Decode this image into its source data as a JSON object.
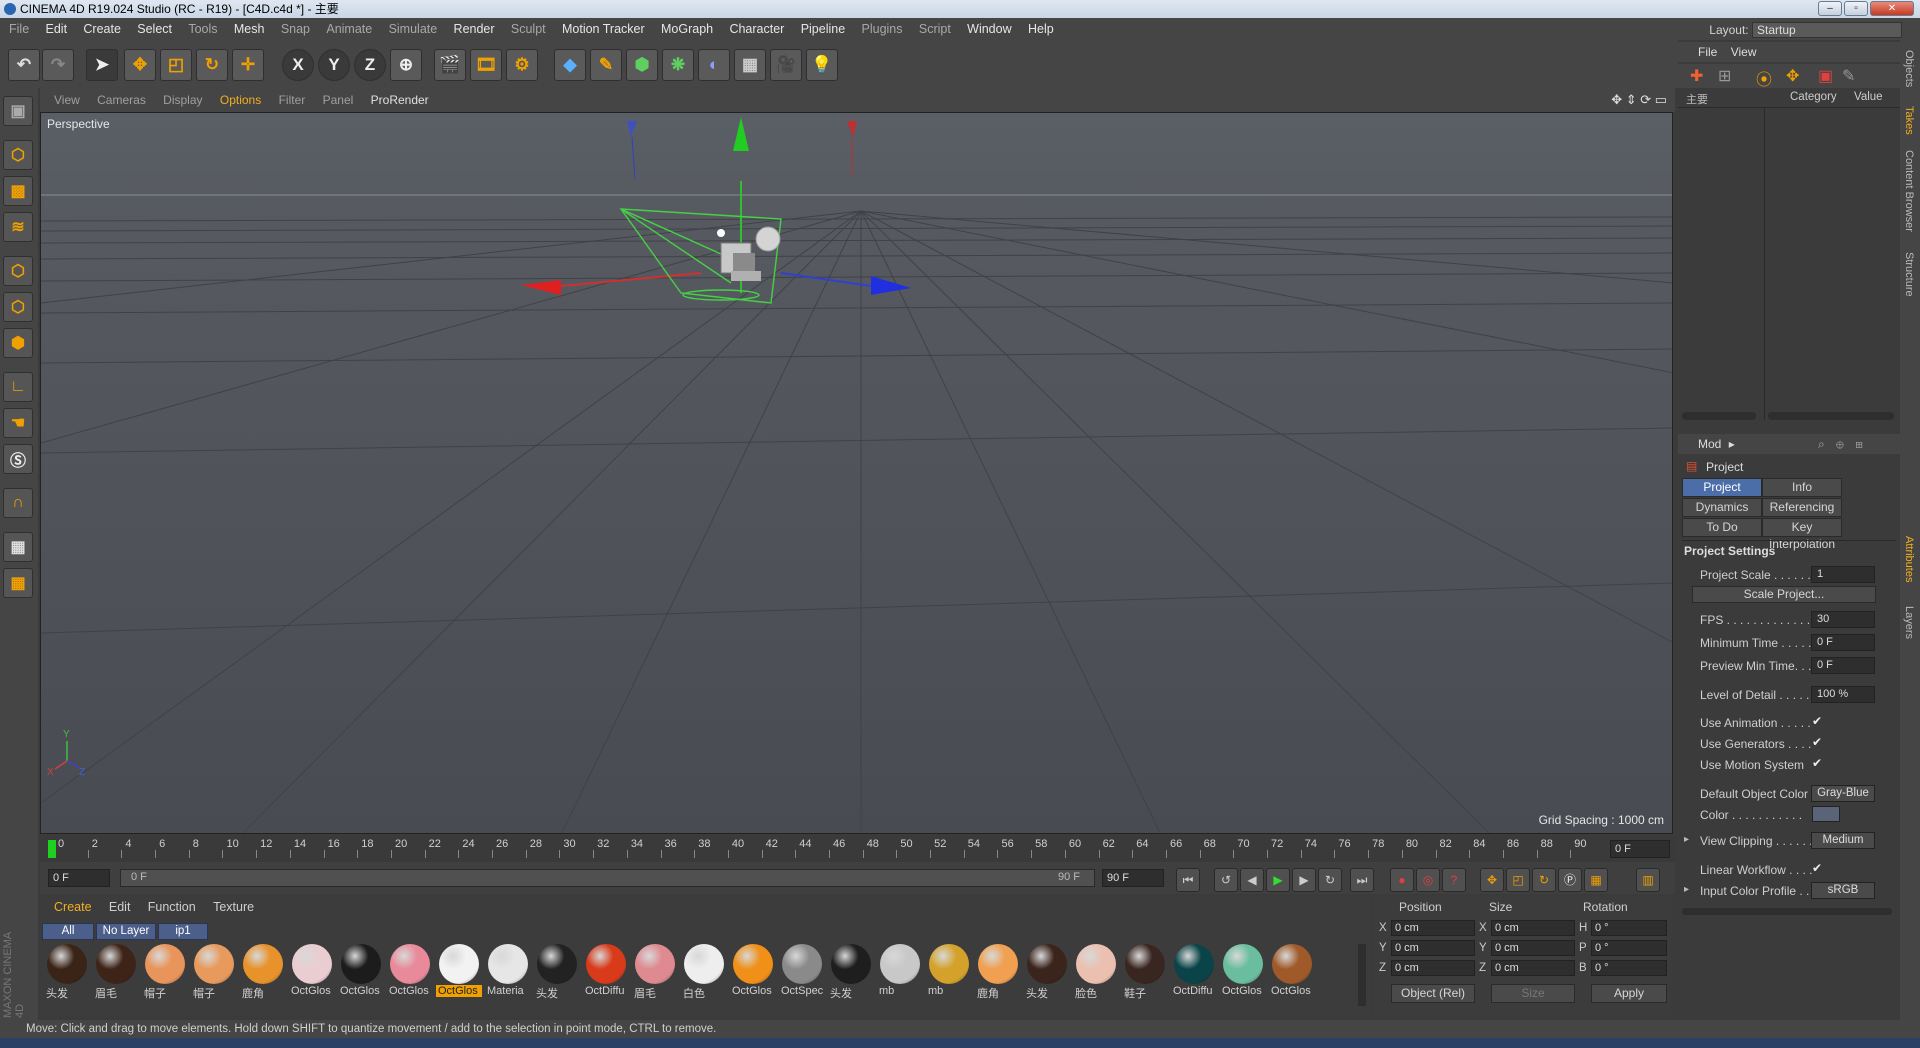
{
  "window": {
    "title": "CINEMA 4D R19.024 Studio (RC - R19) - [C4D.c4d *] - 主要",
    "controls": [
      "minimize",
      "maximize",
      "close"
    ]
  },
  "menubar": {
    "items": [
      "File",
      "Edit",
      "Create",
      "Select",
      "Tools",
      "Mesh",
      "Snap",
      "Animate",
      "Simulate",
      "Render",
      "Sculpt",
      "Motion Tracker",
      "MoGraph",
      "Character",
      "Pipeline",
      "Plugins",
      "Script",
      "Window",
      "Help"
    ],
    "layout_label": "Layout:",
    "layout_value": "Startup"
  },
  "toolbar": {
    "axis_x": "X",
    "axis_y": "Y",
    "axis_z": "Z",
    "tools": [
      "undo-icon",
      "redo-icon",
      "select-icon",
      "move-icon",
      "scale-icon",
      "rotate-icon",
      "live-select-icon",
      "x-axis-lock",
      "y-axis-lock",
      "z-axis-lock",
      "world-coordinates-icon",
      "render-view-icon",
      "render-picture-viewer-icon",
      "edit-render-settings-icon",
      "cube-icon",
      "pen-icon",
      "subdivision-icon",
      "cloner-icon",
      "deformer-icon",
      "floor-icon",
      "camera-icon",
      "light-icon"
    ]
  },
  "viewport": {
    "menu": [
      "View",
      "Cameras",
      "Display",
      "Options",
      "Filter",
      "Panel",
      "ProRender"
    ],
    "label": "Perspective",
    "grid_spacing": "Grid Spacing : 1000 cm",
    "axis_labels": {
      "x": "X",
      "y": "Y",
      "z": "Z"
    }
  },
  "timeline": {
    "ticks": [
      "0",
      "2",
      "4",
      "6",
      "8",
      "10",
      "12",
      "14",
      "16",
      "18",
      "20",
      "22",
      "24",
      "26",
      "28",
      "30",
      "32",
      "34",
      "36",
      "38",
      "40",
      "42",
      "44",
      "46",
      "48",
      "50",
      "52",
      "54",
      "56",
      "58",
      "60",
      "62",
      "64",
      "66",
      "68",
      "70",
      "72",
      "74",
      "76",
      "78",
      "80",
      "82",
      "84",
      "86",
      "88",
      "90"
    ],
    "current_frame": "0 F",
    "start_field": "0 F",
    "range_start": "0 F",
    "range_end": "90 F",
    "end_field": "90 F"
  },
  "materials": {
    "menu": [
      "Create",
      "Edit",
      "Function",
      "Texture"
    ],
    "layer_tabs": [
      "All",
      "No Layer",
      "ip1"
    ],
    "items": [
      {
        "label": "头发",
        "color": "#3a2418"
      },
      {
        "label": "眉毛",
        "color": "#3e2418"
      },
      {
        "label": "帽子",
        "color": "#e8945a"
      },
      {
        "label": "帽子",
        "color": "#e89a5c"
      },
      {
        "label": "鹿角",
        "color": "#e8922c"
      },
      {
        "label": "OctGlos",
        "color": "#eacdd0"
      },
      {
        "label": "OctGlos",
        "color": "#1c1c1c"
      },
      {
        "label": "OctGlos",
        "color": "#e88a9a"
      },
      {
        "label": "OctGlos",
        "color": "#f2f2f2",
        "selected": true
      },
      {
        "label": "Materia",
        "color": "#e6e6e6"
      },
      {
        "label": "头发",
        "color": "#222222"
      },
      {
        "label": "OctDiffu",
        "color": "#d83a1a"
      },
      {
        "label": "眉毛",
        "color": "#de8a90"
      },
      {
        "label": "白色",
        "color": "#eeeeee"
      },
      {
        "label": "OctGlos",
        "color": "#f09018"
      },
      {
        "label": "OctSpec",
        "color": "#8a8a8a"
      },
      {
        "label": "头发",
        "color": "#1e1e1e"
      },
      {
        "label": "mb",
        "color": "#c8c8c8"
      },
      {
        "label": "mb",
        "color": "#d4a22a"
      },
      {
        "label": "鹿角",
        "color": "#f0a050"
      },
      {
        "label": "头发",
        "color": "#3a241c"
      },
      {
        "label": "脸色",
        "color": "#ecc0b0"
      },
      {
        "label": "鞋子",
        "color": "#3a2620"
      },
      {
        "label": "OctDiffu",
        "color": "#0a4448"
      },
      {
        "label": "OctGlos",
        "color": "#6abd9e"
      },
      {
        "label": "OctGlos",
        "color": "#a05a2a"
      }
    ]
  },
  "coordinates": {
    "headers": [
      "Position",
      "Size",
      "Rotation"
    ],
    "rows": [
      {
        "axis": "X",
        "pos": "0 cm",
        "size_axis": "X",
        "size": "0 cm",
        "rot_axis": "H",
        "rot": "0 °"
      },
      {
        "axis": "Y",
        "pos": "0 cm",
        "size_axis": "Y",
        "size": "0 cm",
        "rot_axis": "P",
        "rot": "0 °"
      },
      {
        "axis": "Z",
        "pos": "0 cm",
        "size_axis": "Z",
        "size": "0 cm",
        "rot_axis": "B",
        "rot": "0 °"
      }
    ],
    "mode": "Object (Rel)",
    "size_mode": "Size",
    "apply": "Apply"
  },
  "takes": {
    "menu": [
      "File",
      "View"
    ],
    "main_take": "主要",
    "col_category": "Category",
    "col_value": "Value"
  },
  "attributes": {
    "mode_label": "Mod",
    "object": "Project",
    "tabs": [
      "Project Settings",
      "Info",
      "Dynamics",
      "Referencing",
      "To Do",
      "Key Interpolation"
    ],
    "section": "Project Settings",
    "project_scale_label": "Project Scale . . . . . .",
    "project_scale": "1",
    "scale_project_button": "Scale Project...",
    "fps_label": "FPS . . . . . . . . . . . . . .",
    "fps": "30",
    "min_time_label": "Minimum Time . . . . .",
    "min_time": "0 F",
    "preview_min_label": "Preview Min Time. . .",
    "preview_min": "0 F",
    "lod_label": "Level of Detail . . . . .",
    "lod": "100 %",
    "use_anim_label": "Use Animation . . . . .",
    "use_gen_label": "Use Generators . . . .",
    "use_motion_label": "Use Motion System",
    "check": "✔",
    "default_color_label": "Default Object Color",
    "default_color": "Gray-Blue",
    "color_label": "Color . . . . . . . . . . .",
    "clipping_label": "View Clipping . . . . . .",
    "clipping": "Medium",
    "linear_label": "Linear Workflow . . . .",
    "icp_label": "Input Color Profile . .",
    "icp": "sRGB"
  },
  "side_tabs": [
    "Objects",
    "Takes",
    "Content Browser",
    "Structure",
    "Attributes",
    "Layers"
  ],
  "status": "Move: Click and drag to move elements. Hold down SHIFT to quantize movement / add to the selection in point mode, CTRL to remove.",
  "colors": {
    "accent": "#f0a000",
    "selected_tab": "#4c6ea8",
    "viewport_bg": "#4a4e54"
  }
}
